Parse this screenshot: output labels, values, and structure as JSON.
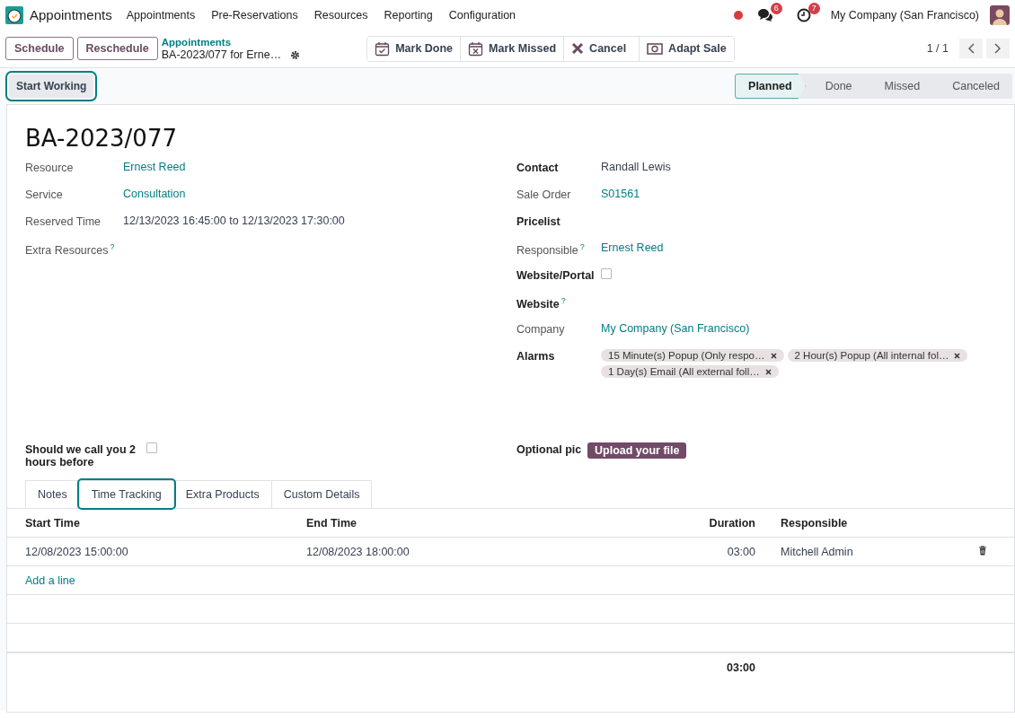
{
  "app": {
    "name": "Appointments"
  },
  "menu": [
    {
      "label": "Appointments"
    },
    {
      "label": "Pre-Reservations"
    },
    {
      "label": "Resources"
    },
    {
      "label": "Reporting"
    },
    {
      "label": "Configuration"
    }
  ],
  "systray": {
    "chat_count": "6",
    "activity_count": "7",
    "company": "My Company (San Francisco)"
  },
  "control": {
    "buttons": [
      "Schedule",
      "Reschedule"
    ],
    "breadcrumb": "Appointments",
    "record": "BA-2023/077 for Erne…",
    "actions": [
      {
        "label": "Mark Done",
        "kind": "done"
      },
      {
        "label": "Mark Missed",
        "kind": "missed"
      },
      {
        "label": "Cancel",
        "kind": "cancel"
      },
      {
        "label": "Adapt Sale",
        "kind": "money"
      }
    ],
    "pager": "1 / 1"
  },
  "start_button": "Start Working",
  "statusbar": [
    {
      "label": "Planned",
      "selected": true
    },
    {
      "label": "Done",
      "selected": false
    },
    {
      "label": "Missed",
      "selected": false
    },
    {
      "label": "Canceled",
      "selected": false
    }
  ],
  "title": "BA-2023/077",
  "left_fields": [
    {
      "label": "Resource",
      "strong": false,
      "kind": "link",
      "value": "Ernest Reed"
    },
    {
      "label": "Service",
      "strong": false,
      "kind": "link",
      "value": "Consultation"
    },
    {
      "label": "Reserved Time",
      "strong": false,
      "kind": "text",
      "value": "12/13/2023 16:45:00 to 12/13/2023 17:30:00"
    },
    {
      "label": "Extra Resources",
      "strong": false,
      "help": "?",
      "kind": "empty"
    }
  ],
  "right_fields": [
    {
      "label": "Contact",
      "strong": true,
      "kind": "text",
      "value": "Randall Lewis"
    },
    {
      "label": "Sale Order",
      "strong": false,
      "kind": "link",
      "value": "S01561"
    },
    {
      "label": "Pricelist",
      "strong": true,
      "kind": "empty"
    },
    {
      "label": "Responsible",
      "strong": false,
      "help": "?",
      "kind": "link",
      "value": "Ernest Reed"
    },
    {
      "label": "Website/Portal",
      "strong": true,
      "kind": "checkbox",
      "checked": false
    },
    {
      "label": "Website",
      "strong": true,
      "help": "?",
      "kind": "empty"
    },
    {
      "label": "Company",
      "strong": false,
      "kind": "link",
      "value": "My Company (San Francisco)"
    },
    {
      "label": "Alarms",
      "strong": true,
      "kind": "tags",
      "tags": [
        "15 Minute(s) Popup (Only respo…",
        "2 Hour(s) Popup (All internal fol…",
        "1 Day(s) Email (All external foll…"
      ]
    }
  ],
  "call_field": {
    "label": "Should we call you 2 hours before",
    "checked": false
  },
  "pic_field": {
    "label": "Optional pic",
    "button": "Upload your file"
  },
  "tabs": [
    {
      "label": "Notes",
      "selected": false
    },
    {
      "label": "Time Tracking",
      "selected": true
    },
    {
      "label": "Extra Products",
      "selected": false
    },
    {
      "label": "Custom Details",
      "selected": false
    }
  ],
  "table": {
    "columns": [
      {
        "label": "Start Time"
      },
      {
        "label": "End Time"
      },
      {
        "label": "Duration"
      },
      {
        "label": "Responsible"
      }
    ],
    "rows": [
      {
        "cells": [
          "12/08/2023 15:00:00",
          "12/08/2023 18:00:00",
          "03:00",
          "Mitchell Admin"
        ]
      }
    ],
    "add_line": "Add a line",
    "total": "03:00"
  }
}
